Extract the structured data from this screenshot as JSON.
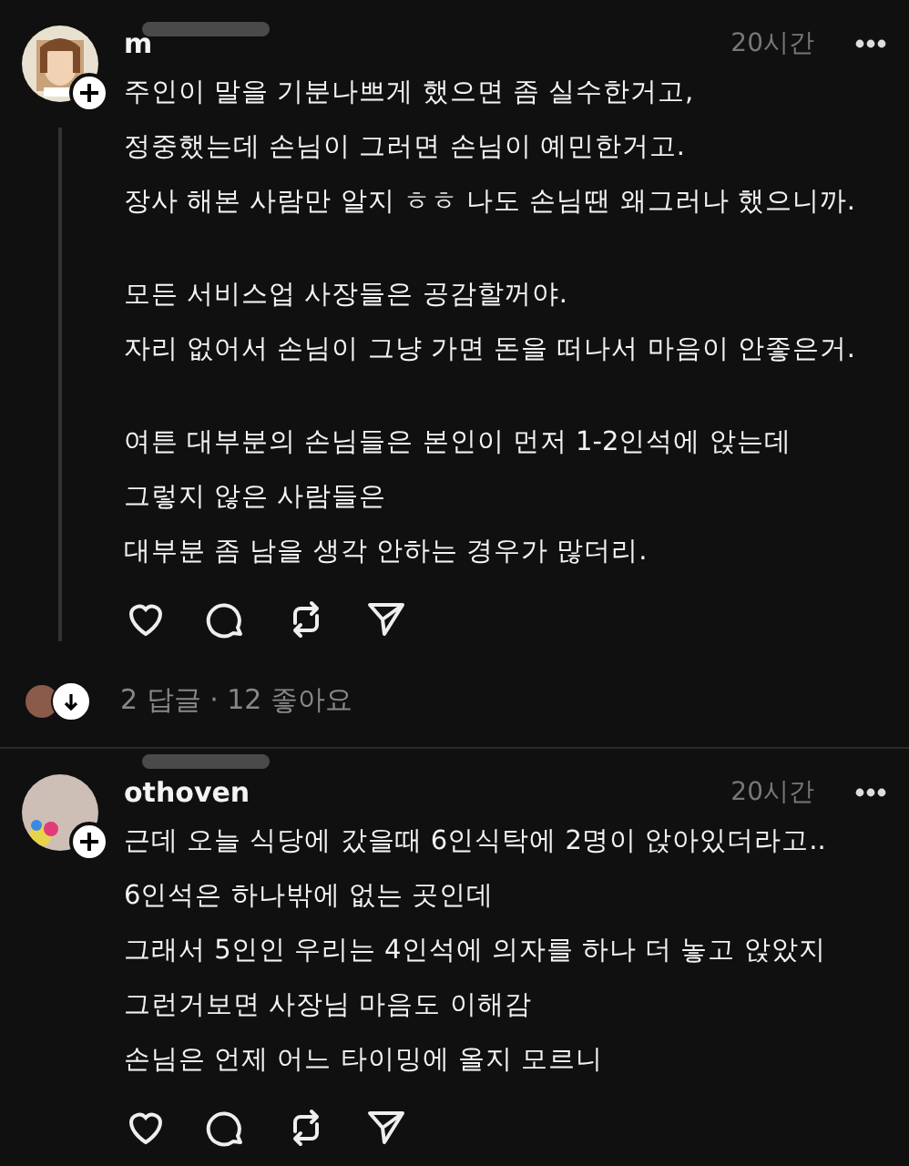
{
  "posts": [
    {
      "username": "m",
      "time": "20시간",
      "thread_line": true,
      "paragraphs": [
        "주인이 말을 기분나쁘게 했으면 좀 실수한거고,\n정중했는데 손님이 그러면 손님이 예민한거고.\n장사 해본 사람만 알지 ㅎㅎ 나도 손님땐 왜그러나 했으니까.",
        "모든 서비스업 사장들은 공감할꺼야.\n자리 없어서 손님이 그냥 가면 돈을 떠나서 마음이 안좋은거.",
        "여튼 대부분의 손님들은 본인이 먼저 1-2인석에 앉는데\n그렇지 않은 사람들은\n대부분 좀 남을 생각 안하는 경우가 많더리."
      ],
      "replies": "2 답글 · 12 좋아요"
    },
    {
      "username": "othoven",
      "time": "20시간",
      "thread_line": false,
      "paragraphs": [
        "근데 오늘 식당에 갔을때 6인식탁에 2명이 앉아있더라고..\n6인석은 하나밖에 없는 곳인데\n그래서 5인인 우리는 4인석에 의자를 하나 더 놓고 앉았지\n그런거보면 사장님 마음도 이해감\n손님은 언제 어느 타이밍에 올지 모르니"
      ]
    }
  ]
}
